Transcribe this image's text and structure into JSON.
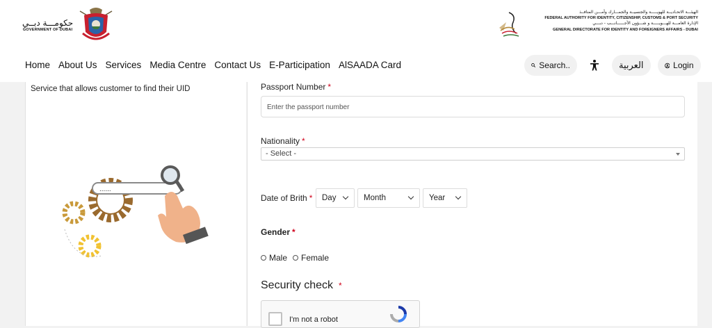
{
  "header": {
    "logo_left": {
      "arabic": "حكومـــة دبــي",
      "english": "GOVERNMENT OF DUBAI",
      "emblem": "dubai-government-emblem"
    },
    "logo_right": {
      "line1_ar": "الهيئـــة الاتحـاديــة للهويـــــة والجنسيــة والجمـــارك وأمـــن المنافــذ",
      "line2_en": "FEDERAL AUTHORITY FOR IDENTITY, CITIZENSHIP, CUSTOMS & PORT SECURITY",
      "line3_ar": "الإدارة العامـــة للهـــويـــــة و شـــؤون الأجــــــانـــب - دبـــي",
      "line4_en": "GENERAL DIRECTORATE FOR IDENTITY AND FOREIGNERS AFFAIRS - DUBAI",
      "emblem": "falcon-emblem"
    },
    "nav": [
      "Home",
      "About Us",
      "Services",
      "Media Centre",
      "Contact Us",
      "E-Participation",
      "AlSAADA Card"
    ],
    "search_label": "Search..",
    "language_label": "العربية",
    "login_label": "Login",
    "icons": {
      "search": "search-icon",
      "accessibility": "accessibility-icon",
      "login": "user-circle-icon"
    }
  },
  "left_panel": {
    "description": "Service that allows customer to find their UID",
    "illustration": {
      "search_bar_text": "......"
    }
  },
  "form": {
    "passport": {
      "label": "Passport Number",
      "required": "*",
      "placeholder": "Enter the passport number"
    },
    "nationality": {
      "label": "Nationality",
      "required": "*",
      "selected": "- Select -"
    },
    "dob": {
      "label": "Date of Brith",
      "required": "*",
      "day": "Day",
      "month": "Month",
      "year": "Year"
    },
    "gender": {
      "label": "Gender",
      "required": "*",
      "options": [
        "Male",
        "Female"
      ]
    },
    "security": {
      "title": "Security check",
      "required": "*",
      "captcha_label": "I'm not a robot"
    }
  },
  "colors": {
    "required": "#d0021b",
    "illustration_gold": "#c99a3b",
    "illustration_brown": "#9a6a2e",
    "header_bg": "#ffffff",
    "page_bg": "#f2f2f2"
  }
}
